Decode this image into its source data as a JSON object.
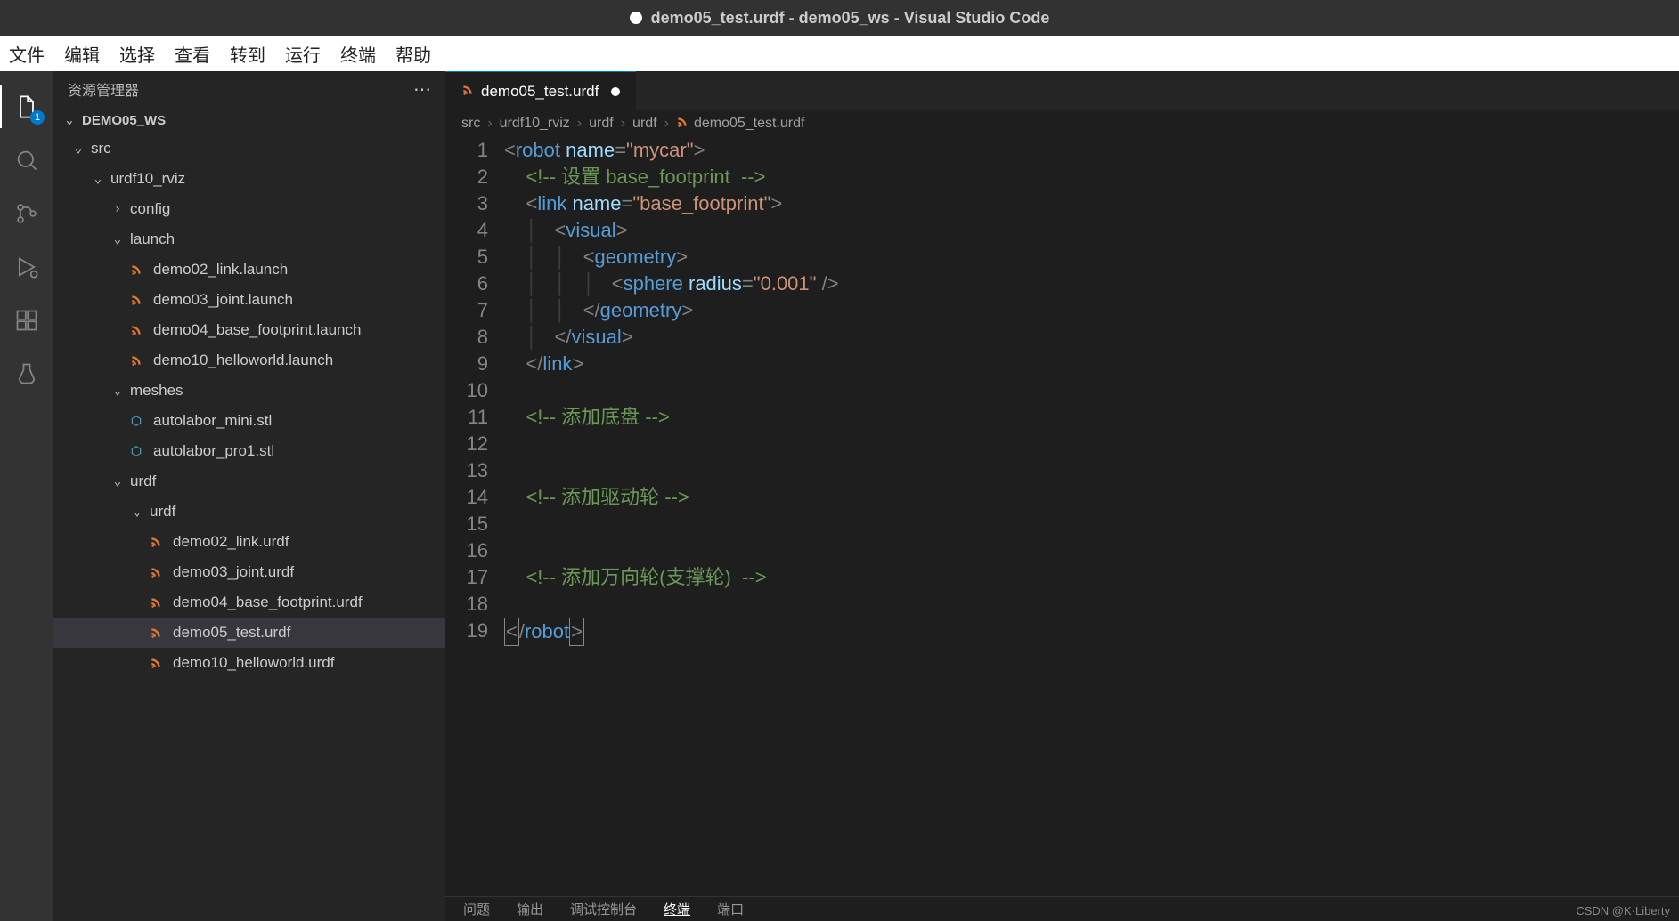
{
  "window_title": "demo05_test.urdf - demo05_ws - Visual Studio Code",
  "menubar": [
    "文件",
    "编辑",
    "选择",
    "查看",
    "转到",
    "运行",
    "终端",
    "帮助"
  ],
  "activity_badge": "1",
  "sidebar": {
    "title": "资源管理器",
    "project": "DEMO05_WS",
    "tree": [
      {
        "depth": 0,
        "type": "folder",
        "open": true,
        "label": "src"
      },
      {
        "depth": 1,
        "type": "folder",
        "open": true,
        "label": "urdf10_rviz"
      },
      {
        "depth": 2,
        "type": "folder",
        "open": false,
        "label": "config"
      },
      {
        "depth": 2,
        "type": "folder",
        "open": true,
        "label": "launch"
      },
      {
        "depth": 3,
        "type": "file",
        "icon": "rss",
        "label": "demo02_link.launch"
      },
      {
        "depth": 3,
        "type": "file",
        "icon": "rss",
        "label": "demo03_joint.launch"
      },
      {
        "depth": 3,
        "type": "file",
        "icon": "rss",
        "label": "demo04_base_footprint.launch"
      },
      {
        "depth": 3,
        "type": "file",
        "icon": "rss",
        "label": "demo10_helloworld.launch"
      },
      {
        "depth": 2,
        "type": "folder",
        "open": true,
        "label": "meshes"
      },
      {
        "depth": 3,
        "type": "file",
        "icon": "stl",
        "label": "autolabor_mini.stl"
      },
      {
        "depth": 3,
        "type": "file",
        "icon": "stl",
        "label": "autolabor_pro1.stl"
      },
      {
        "depth": 2,
        "type": "folder",
        "open": true,
        "label": "urdf"
      },
      {
        "depth": 3,
        "type": "folder",
        "open": true,
        "label": "urdf"
      },
      {
        "depth": 4,
        "type": "file",
        "icon": "rss",
        "label": "demo02_link.urdf"
      },
      {
        "depth": 4,
        "type": "file",
        "icon": "rss",
        "label": "demo03_joint.urdf"
      },
      {
        "depth": 4,
        "type": "file",
        "icon": "rss",
        "label": "demo04_base_footprint.urdf"
      },
      {
        "depth": 4,
        "type": "file",
        "icon": "rss",
        "label": "demo05_test.urdf",
        "selected": true
      },
      {
        "depth": 4,
        "type": "file",
        "icon": "rss",
        "label": "demo10_helloworld.urdf"
      }
    ]
  },
  "tab": {
    "label": "demo05_test.urdf",
    "dirty": true
  },
  "breadcrumbs": [
    "src",
    "urdf10_rviz",
    "urdf",
    "urdf",
    "demo05_test.urdf"
  ],
  "code": {
    "line_count": 19,
    "lines": [
      {
        "n": 1,
        "html": "<span class='tok-punct'>&lt;</span><span class='tok-tag'>robot</span> <span class='tok-attr'>name</span><span class='tok-punct'>=</span><span class='tok-str'>\"mycar\"</span><span class='tok-punct'>&gt;</span>"
      },
      {
        "n": 2,
        "html": "    <span class='tok-comment'>&lt;!-- 设置 base_footprint  --&gt;</span>"
      },
      {
        "n": 3,
        "html": "    <span class='tok-punct'>&lt;</span><span class='tok-tag'>link</span> <span class='tok-attr'>name</span><span class='tok-punct'>=</span><span class='tok-str'>\"base_footprint\"</span><span class='tok-punct'>&gt;</span>"
      },
      {
        "n": 4,
        "html": "    <span class='indent-guide'>│</span>   <span class='tok-punct'>&lt;</span><span class='tok-tag'>visual</span><span class='tok-punct'>&gt;</span>"
      },
      {
        "n": 5,
        "html": "    <span class='indent-guide'>│</span>   <span class='indent-guide'>│</span>   <span class='tok-punct'>&lt;</span><span class='tok-tag'>geometry</span><span class='tok-punct'>&gt;</span>"
      },
      {
        "n": 6,
        "html": "    <span class='indent-guide'>│</span>   <span class='indent-guide'>│</span>   <span class='indent-guide'>│</span>   <span class='tok-punct'>&lt;</span><span class='tok-tag'>sphere</span> <span class='tok-attr'>radius</span><span class='tok-punct'>=</span><span class='tok-str'>\"0.001\"</span> <span class='tok-punct'>/&gt;</span>"
      },
      {
        "n": 7,
        "html": "    <span class='indent-guide'>│</span>   <span class='indent-guide'>│</span>   <span class='tok-punct'>&lt;/</span><span class='tok-tag'>geometry</span><span class='tok-punct'>&gt;</span>"
      },
      {
        "n": 8,
        "html": "    <span class='indent-guide'>│</span>   <span class='tok-punct'>&lt;/</span><span class='tok-tag'>visual</span><span class='tok-punct'>&gt;</span>"
      },
      {
        "n": 9,
        "html": "    <span class='tok-punct'>&lt;/</span><span class='tok-tag'>link</span><span class='tok-punct'>&gt;</span>"
      },
      {
        "n": 10,
        "html": ""
      },
      {
        "n": 11,
        "html": "    <span class='tok-comment'>&lt;!-- 添加底盘 --&gt;</span>"
      },
      {
        "n": 12,
        "html": ""
      },
      {
        "n": 13,
        "html": ""
      },
      {
        "n": 14,
        "html": "    <span class='tok-comment'>&lt;!-- 添加驱动轮 --&gt;</span>"
      },
      {
        "n": 15,
        "html": ""
      },
      {
        "n": 16,
        "html": ""
      },
      {
        "n": 17,
        "html": "    <span class='tok-comment'>&lt;!-- 添加万向轮(支撑轮)  --&gt;</span>"
      },
      {
        "n": 18,
        "html": ""
      },
      {
        "n": 19,
        "html": "<span class='box-outline'><span class='tok-punct'>&lt;</span></span><span class='tok-punct'>/</span><span class='tok-tag'>robot</span><span class='box-outline'><span class='tok-punct'>&gt;</span></span>"
      }
    ]
  },
  "bottom_panel": [
    "问题",
    "输出",
    "调试控制台",
    "终端",
    "端口"
  ],
  "bottom_active": "终端",
  "watermark": "CSDN @K·Liberty"
}
